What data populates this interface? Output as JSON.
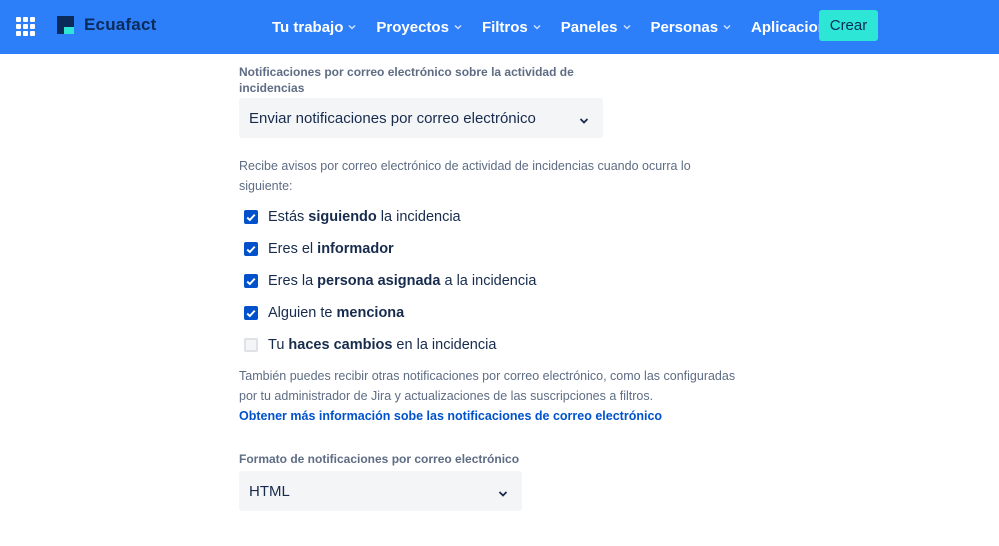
{
  "colors": {
    "topbar_bg": "#2d7ff9",
    "create_bg": "#2ee6d6",
    "checkbox_checked": "#0052cc",
    "link": "#0052cc"
  },
  "header": {
    "app_switcher_icon": "grid-icon",
    "brand_name": "Ecuafact",
    "nav": [
      {
        "label": "Tu trabajo",
        "icon": "chevron-down-icon"
      },
      {
        "label": "Proyectos",
        "icon": "chevron-down-icon"
      },
      {
        "label": "Filtros",
        "icon": "chevron-down-icon"
      },
      {
        "label": "Paneles",
        "icon": "chevron-down-icon"
      },
      {
        "label": "Personas",
        "icon": "chevron-down-icon"
      },
      {
        "label": "Aplicaciones",
        "icon": "chevron-down-icon"
      }
    ],
    "create_label": "Crear"
  },
  "email_activity": {
    "label_line1": "Notificaciones por correo electrónico sobre la actividad de",
    "label_line2": "incidencias",
    "selected": "Enviar notificaciones por correo electrónico"
  },
  "receive": {
    "text_line1": "Recibe avisos por correo electrónico de actividad de incidencias cuando ocurra lo",
    "text_line2": "siguiente:"
  },
  "checkboxes": [
    {
      "pre": "Estás ",
      "bold": "siguiendo",
      "post": " la incidencia",
      "checked": true
    },
    {
      "pre": "Eres el ",
      "bold": "informador",
      "post": "",
      "checked": true
    },
    {
      "pre": "Eres la ",
      "bold": "persona asignada",
      "post": " a la incidencia",
      "checked": true
    },
    {
      "pre": "Alguien te ",
      "bold": "menciona",
      "post": "",
      "checked": true
    },
    {
      "pre": "Tu ",
      "bold": "haces cambios",
      "post": " en la incidencia",
      "checked": false
    }
  ],
  "also": {
    "text_line1": "También puedes recibir otras notificaciones por correo electrónico, como las configuradas",
    "text_line2": "por tu administrador de Jira y actualizaciones de las suscripciones a filtros.",
    "link": "Obtener más información sobe las notificaciones de correo electrónico"
  },
  "format": {
    "label": "Formato de notificaciones por correo electrónico",
    "selected": "HTML"
  }
}
